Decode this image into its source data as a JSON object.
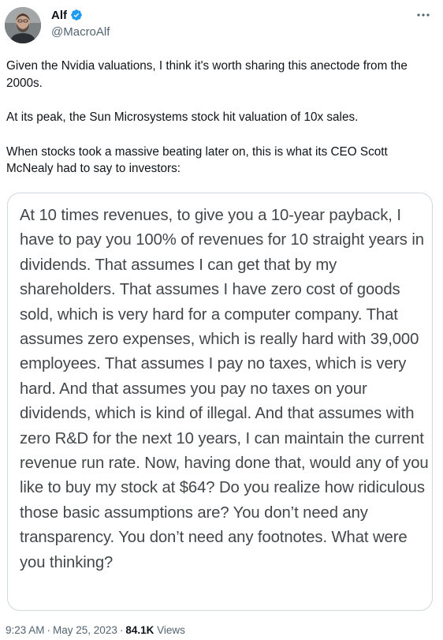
{
  "author": {
    "display_name": "Alf",
    "handle": "@MacroAlf",
    "verified": true,
    "verified_color": "#1d9bf0"
  },
  "more_icon": "more-horizontal-icon",
  "tweet": {
    "paragraphs": [
      "Given the Nvidia valuations, I think it's worth sharing this anectode from the 2000s.",
      "At its peak, the Sun Microsystems stock hit valuation of 10x sales.",
      "When stocks took a massive beating later on, this is what its CEO Scott McNealy had to say to investors:"
    ]
  },
  "quote_image": {
    "text": "At 10 times revenues, to give you a 10-year payback, I have to pay you 100% of revenues for 10 straight years in dividends. That assumes I can get that by my shareholders. That assumes I have zero cost of goods sold, which is very hard for a computer company. That assumes zero expenses, which is really hard with 39,000 employees. That assumes I pay no taxes, which is very hard. And that assumes you pay no taxes on your dividends, which is kind of illegal. And that assumes with zero R&D for the next 10 years, I can maintain the current revenue run rate. Now, having done that, would any of you like to buy my stock at $64? Do you realize how ridiculous those basic assumptions are? You don’t need any transparency. You don’t need any footnotes. What were you thinking?"
  },
  "meta": {
    "time": "9:23 AM",
    "separator": "·",
    "date": "May 25, 2023",
    "views_count": "84.1K",
    "views_label": "Views"
  }
}
